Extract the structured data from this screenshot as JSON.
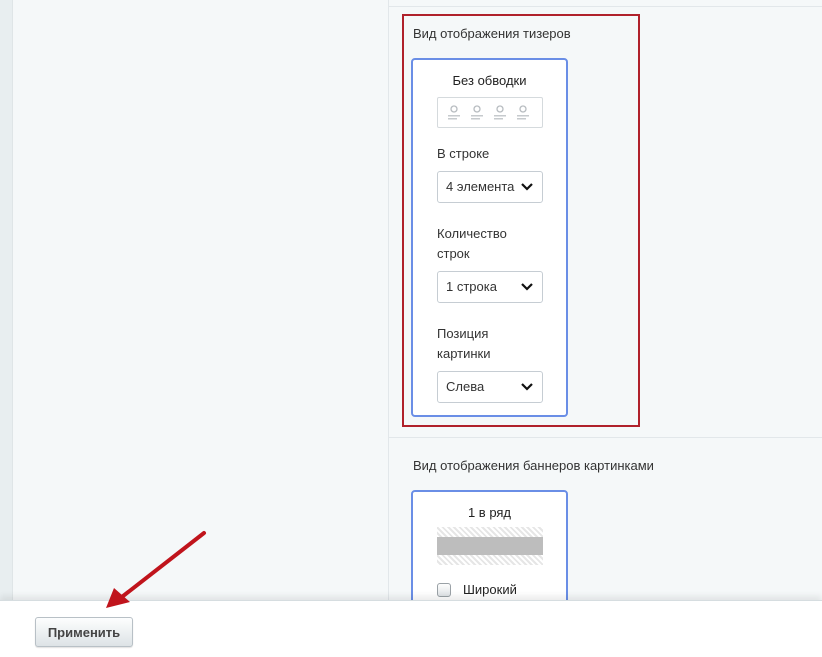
{
  "teasers": {
    "section_title": "Вид отображения тизеров",
    "card_title": "Без обводки",
    "per_row": {
      "label": "В строке",
      "value": "4 элемента"
    },
    "rows_count": {
      "label_line1": "Количество",
      "label_line2": "строк",
      "value": "1 строка"
    },
    "image_position": {
      "label_line1": "Позиция",
      "label_line2": "картинки",
      "value": "Слева"
    }
  },
  "banners": {
    "section_title": "Вид отображения баннеров картинками",
    "card_title": "1 в ряд",
    "wide_checkbox_label": "Широкий",
    "wide_checked": false
  },
  "footer": {
    "apply_label": "Применить"
  },
  "colors": {
    "highlight_border": "#b0212b",
    "card_border": "#6a8ee6",
    "arrow": "#c0141c"
  }
}
